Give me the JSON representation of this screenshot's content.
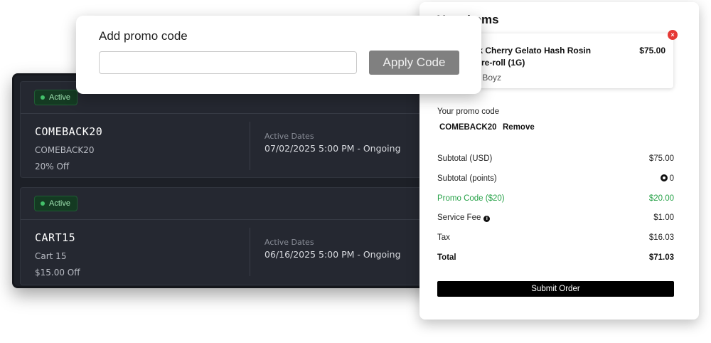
{
  "promo_list": {
    "cards": [
      {
        "status": "Active",
        "code": "COMEBACK20",
        "name": "COMEBACK20",
        "discount": "20% Off",
        "dates_label": "Active Dates",
        "dates_value": "07/02/2025 5:00 PM - Ongoing"
      },
      {
        "status": "Active",
        "code": "CART15",
        "name": "Cart 15",
        "discount": "$15.00 Off",
        "dates_label": "Active Dates",
        "dates_value": "06/16/2025 5:00 PM - Ongoing"
      }
    ]
  },
  "order": {
    "title": "Your items",
    "item": {
      "name": "Backpack Cherry Gelato Hash Rosin Infused Pre-roll (1G)",
      "price": "$75.00",
      "brand": "Backpack Boyz",
      "remove_icon": "×"
    },
    "promo_label": "Your promo code",
    "promo_code": "COMEBACK20",
    "promo_remove": "Remove",
    "summary": [
      {
        "label": "Subtotal (USD)",
        "value": "$75.00"
      },
      {
        "label": "Subtotal (points)",
        "value": "0"
      },
      {
        "label": "Promo Code ($20)",
        "value": "$20.00"
      },
      {
        "label": "Service Fee",
        "value": "$1.00"
      },
      {
        "label": "Tax",
        "value": "$16.03"
      },
      {
        "label": "Total",
        "value": "$71.03"
      }
    ],
    "submit_label": "Submit Order",
    "info_icon": "i",
    "accent_green": "#27a248"
  },
  "promo_entry": {
    "title": "Add promo code",
    "input_value": "",
    "apply_label": "Apply Code"
  }
}
